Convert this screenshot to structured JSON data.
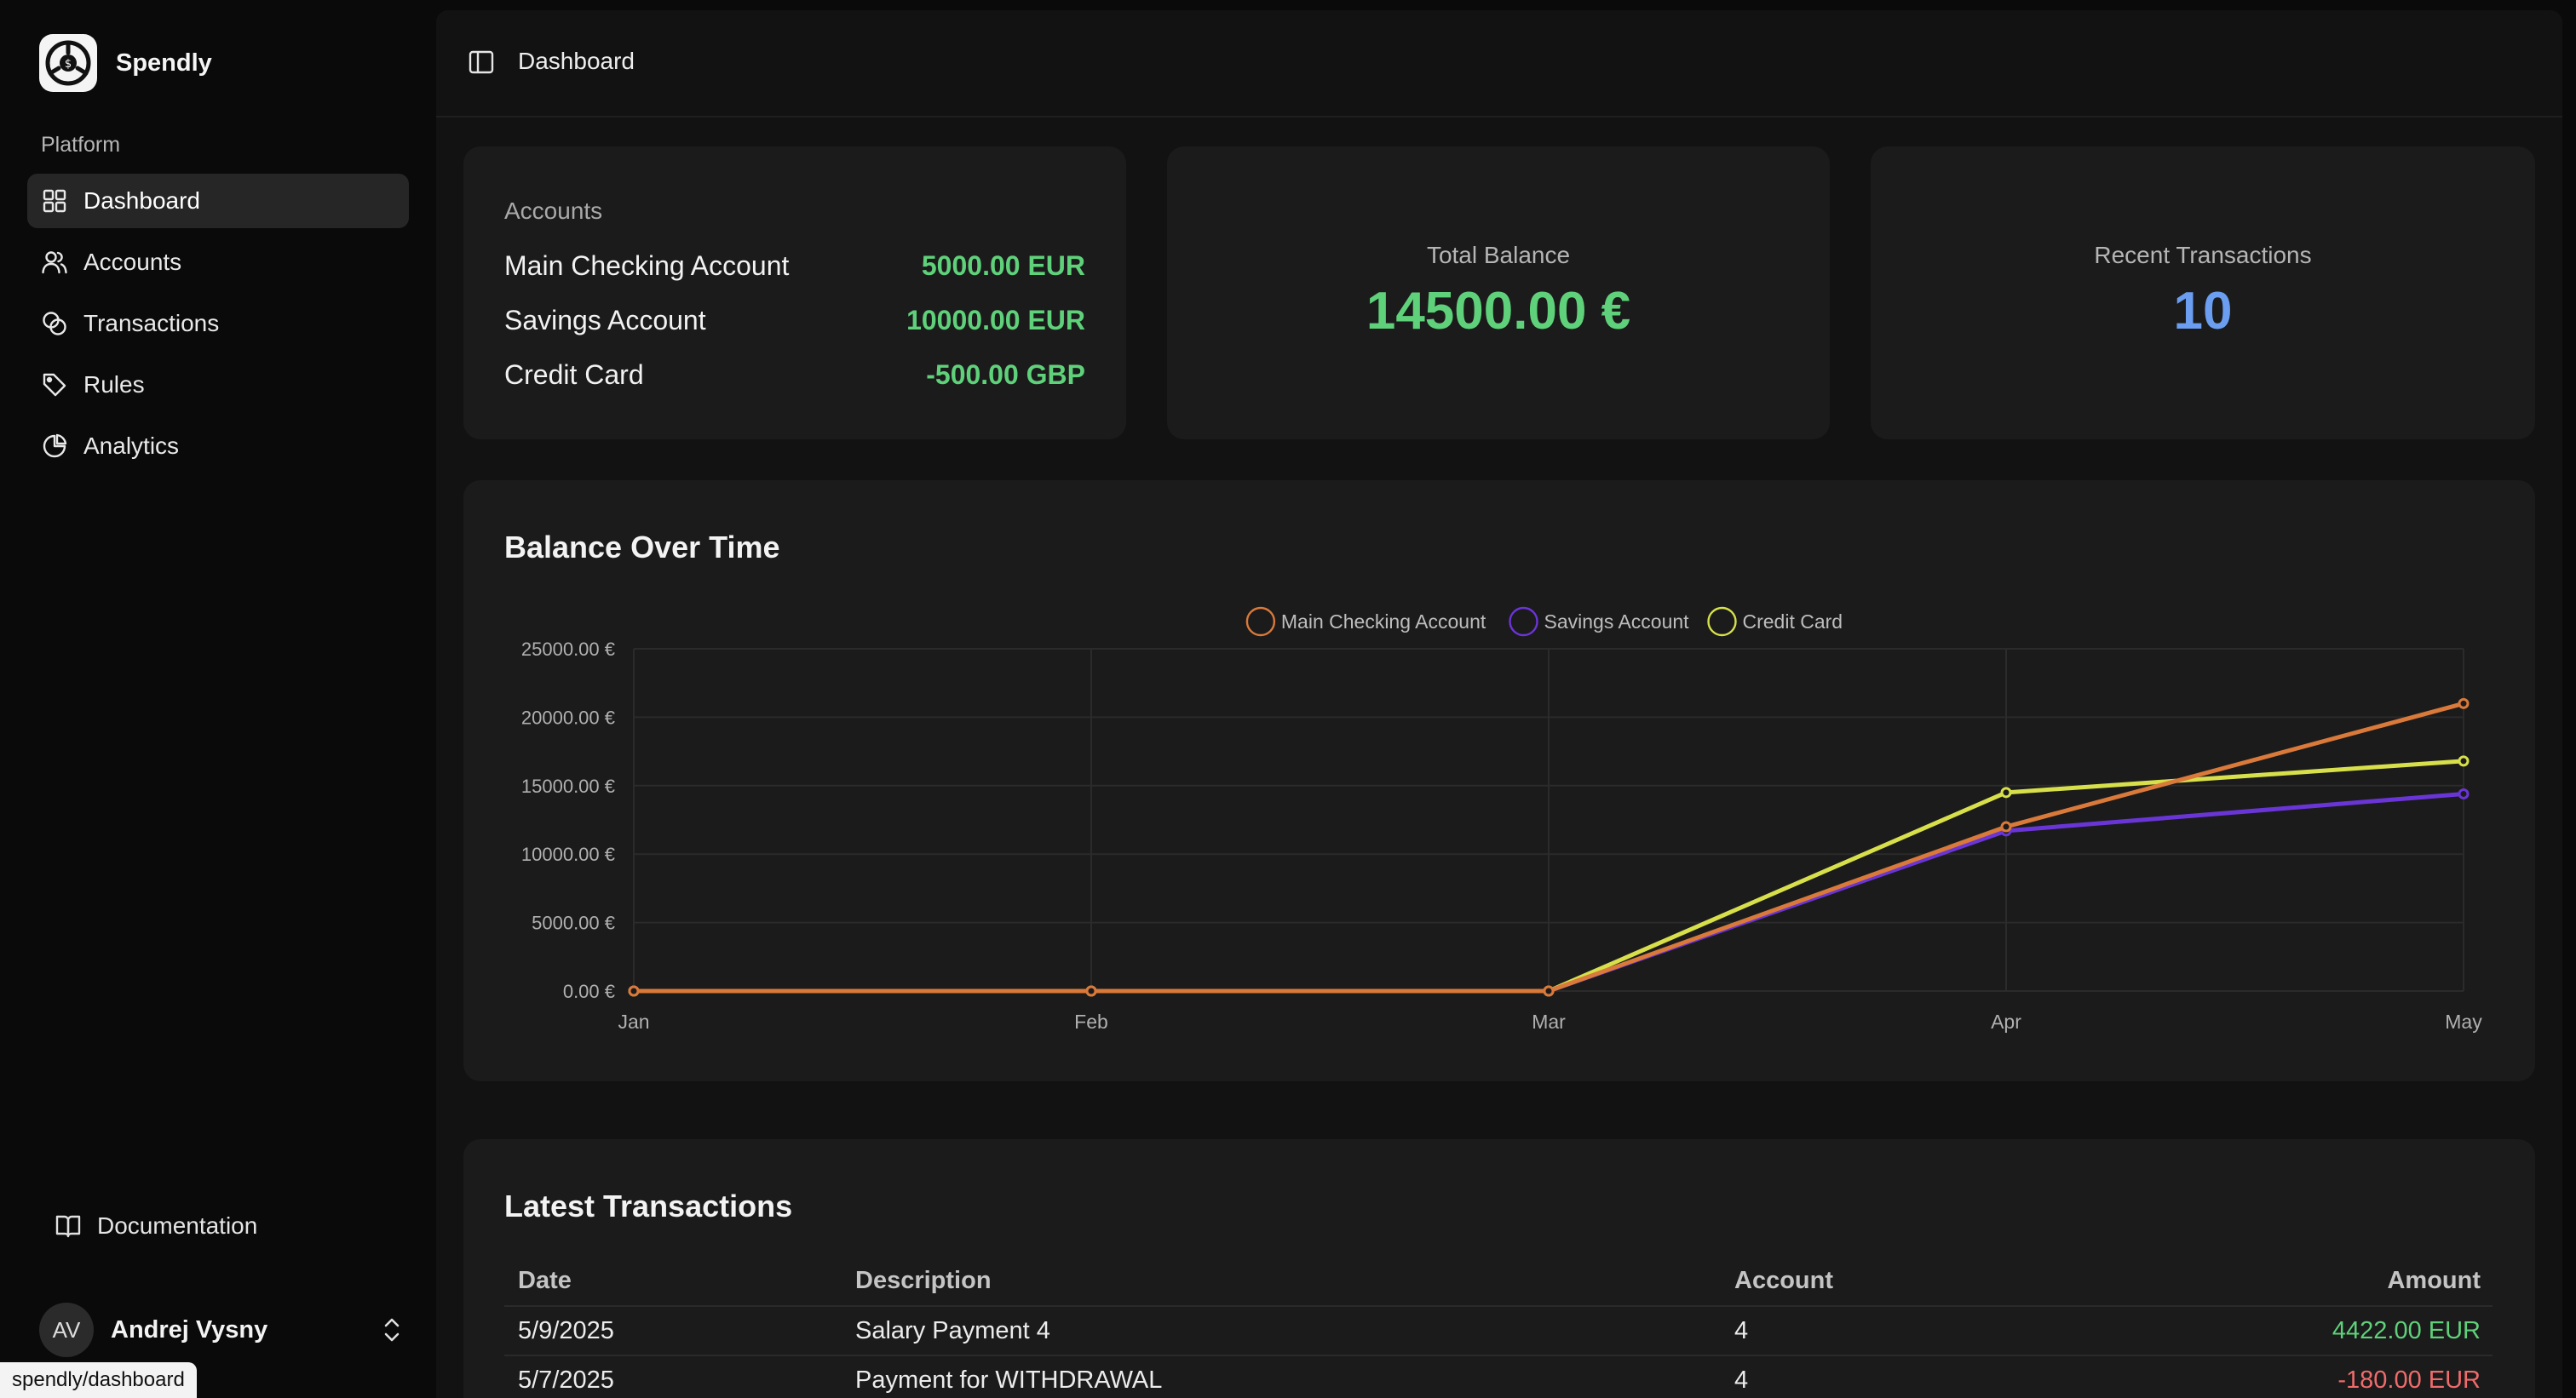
{
  "brand": {
    "name": "Spendly"
  },
  "sidebar": {
    "section_label": "Platform",
    "items": [
      {
        "label": "Dashboard",
        "icon": "grid-icon",
        "active": true
      },
      {
        "label": "Accounts",
        "icon": "users-icon",
        "active": false
      },
      {
        "label": "Transactions",
        "icon": "coins-icon",
        "active": false
      },
      {
        "label": "Rules",
        "icon": "tag-icon",
        "active": false
      },
      {
        "label": "Analytics",
        "icon": "pie-chart-icon",
        "active": false
      }
    ],
    "documentation": "Documentation",
    "user": {
      "initials": "AV",
      "name": "Andrej Vysny"
    }
  },
  "status_url": "spendly/dashboard",
  "header": {
    "breadcrumb": "Dashboard"
  },
  "accounts_card": {
    "title": "Accounts",
    "rows": [
      {
        "name": "Main Checking Account",
        "value": "5000.00 EUR"
      },
      {
        "name": "Savings Account",
        "value": "10000.00 EUR"
      },
      {
        "name": "Credit Card",
        "value": "-500.00 GBP"
      }
    ]
  },
  "total_balance": {
    "label": "Total Balance",
    "value": "14500.00 €",
    "color": "#5fd17a"
  },
  "recent_transactions": {
    "label": "Recent Transactions",
    "value": "10",
    "color": "#6b9ef0"
  },
  "chart_title": "Balance Over Time",
  "chart_data": {
    "type": "line",
    "title": "Balance Over Time",
    "categories": [
      "Jan",
      "Feb",
      "Mar",
      "Apr",
      "May"
    ],
    "ylim": [
      0,
      25000
    ],
    "yticks": [
      "0.00 €",
      "5000.00 €",
      "10000.00 €",
      "15000.00 €",
      "20000.00 €",
      "25000.00 €"
    ],
    "legend_position": "top-center",
    "grid": true,
    "series": [
      {
        "name": "Main Checking Account",
        "color": "#d9793a",
        "values": [
          0,
          0,
          0,
          12000,
          21000
        ]
      },
      {
        "name": "Savings Account",
        "color": "#6a35d6",
        "values": [
          0,
          0,
          0,
          11700,
          14400
        ]
      },
      {
        "name": "Credit Card",
        "color": "#d7e04a",
        "values": [
          0,
          0,
          0,
          14500,
          16800
        ]
      }
    ]
  },
  "transactions": {
    "title": "Latest Transactions",
    "columns": [
      "Date",
      "Description",
      "Account",
      "Amount"
    ],
    "rows": [
      {
        "date": "5/9/2025",
        "description": "Salary Payment 4",
        "account": "4",
        "amount": "4422.00 EUR",
        "sign": "pos"
      },
      {
        "date": "5/7/2025",
        "description": "Payment for WITHDRAWAL",
        "account": "4",
        "amount": "-180.00 EUR",
        "sign": "neg"
      }
    ]
  }
}
